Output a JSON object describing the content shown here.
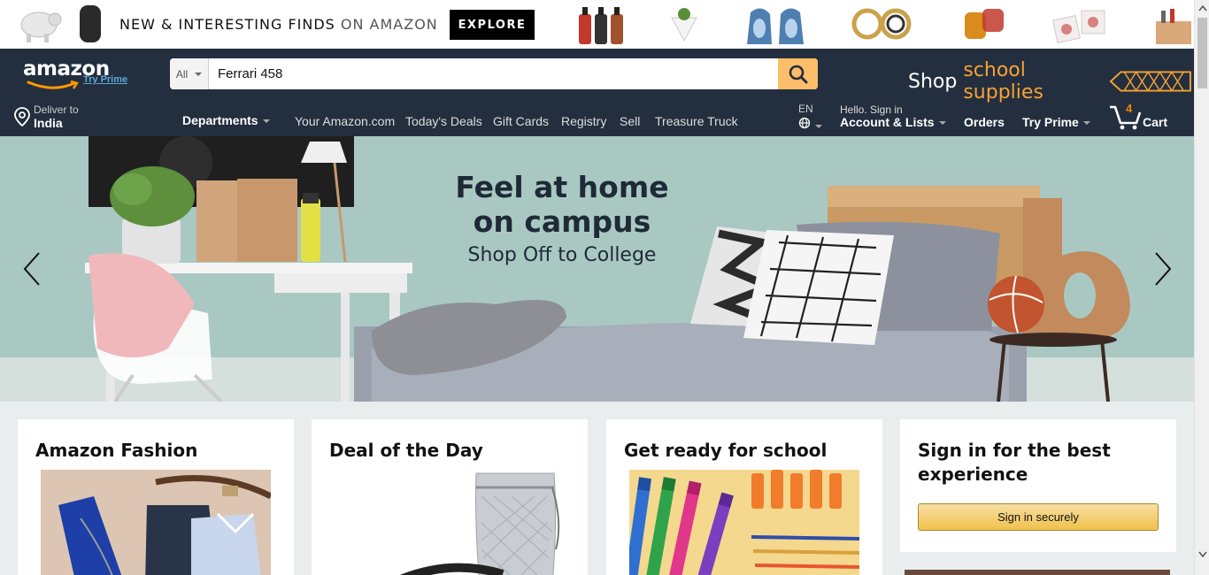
{
  "promo": {
    "text_strong": "NEW & INTERESTING FINDS",
    "text_light": "ON AMAZON",
    "cta": "EXPLORE"
  },
  "header": {
    "logo_word": "amazon",
    "try_prime_link": "Try Prime",
    "search_category": "All",
    "search_value": "Ferrari 458",
    "promo_shop": "Shop",
    "promo_school": "school supplies",
    "deliver_line1": "Deliver to",
    "deliver_line2": "India",
    "departments": "Departments",
    "links": [
      "Your Amazon.com",
      "Today's Deals",
      "Gift Cards",
      "Registry",
      "Sell",
      "Treasure Truck"
    ],
    "lang": "EN",
    "account_line1": "Hello. Sign in",
    "account_line2": "Account & Lists",
    "orders": "Orders",
    "try_prime": "Try Prime",
    "cart_count": "4",
    "cart": "Cart"
  },
  "hero": {
    "title_line1": "Feel at home",
    "title_line2": "on campus",
    "subtitle": "Shop Off to College"
  },
  "cards": {
    "fashion_title": "Amazon Fashion",
    "deal_title": "Deal of the Day",
    "school_title": "Get ready for school",
    "signin_title": "Sign in for the best experience",
    "signin_button": "Sign in securely"
  },
  "colors": {
    "nav_bg": "#232f3e",
    "search_button": "#febd69",
    "accent_orange": "#f7a234",
    "page_bg": "#eaeded"
  }
}
